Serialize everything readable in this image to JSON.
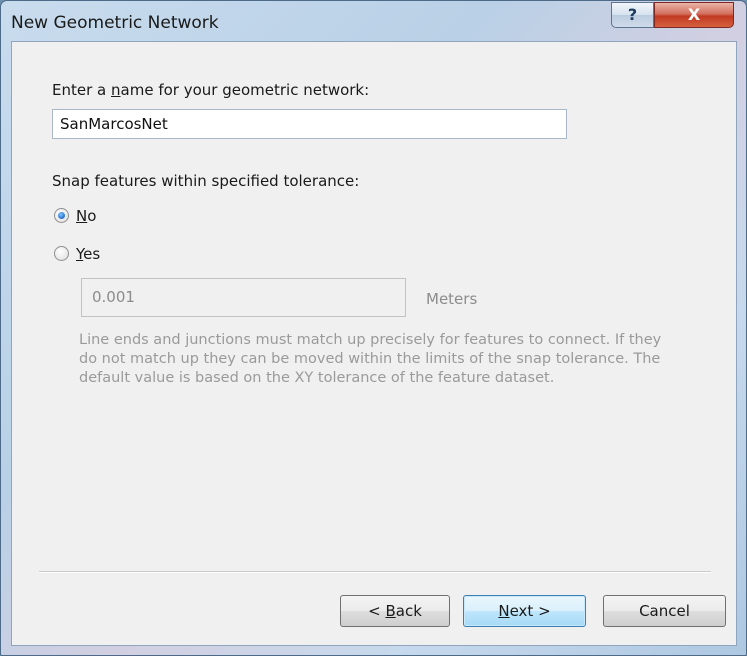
{
  "window": {
    "title": "New Geometric Network",
    "help_glyph": "?",
    "close_glyph": "X"
  },
  "form": {
    "name_label": "Enter a name for your geometric network:",
    "name_value": "SanMarcosNet",
    "snap_label": "Snap features within specified tolerance:",
    "radio_no": "No",
    "radio_yes": "Yes",
    "selected": "No",
    "tolerance_value": "0.001",
    "tolerance_units": "Meters",
    "description": "Line ends and junctions must match up precisely for features to connect. If they do not match up they can be moved within the limits of the snap tolerance. The default value is based on the XY tolerance of the feature dataset."
  },
  "buttons": {
    "back": "< Back",
    "next": "Next >",
    "cancel": "Cancel"
  },
  "icons": {
    "help": "help-icon",
    "close": "close-icon"
  },
  "colors": {
    "close_red": "#c23a22",
    "default_button_blue": "#3c7fb1",
    "disabled_text": "#9a9a9a"
  }
}
